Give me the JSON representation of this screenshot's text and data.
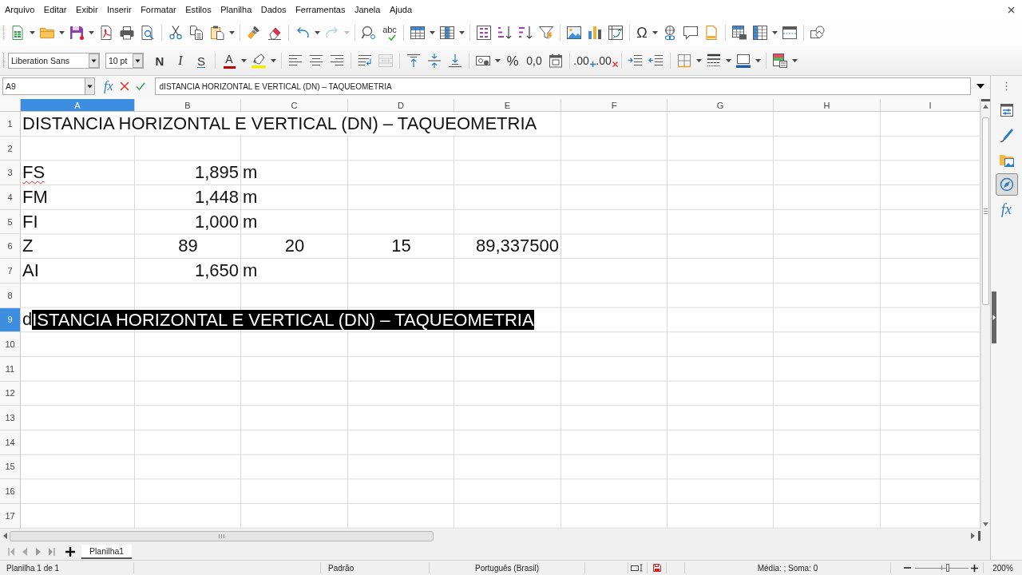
{
  "menu": [
    "Arquivo",
    "Editar",
    "Exibir",
    "Inserir",
    "Formatar",
    "Estilos",
    "Planilha",
    "Dados",
    "Ferramentas",
    "Janela",
    "Ajuda"
  ],
  "toolbar_1": [
    [
      {
        "disabled": false
      },
      {
        "disabled": false
      },
      {
        "disabled": false
      },
      {
        "disabled": false
      },
      {
        "disabled": false
      },
      {
        "disabled": false
      }
    ],
    [
      {
        "disabled": false
      },
      {
        "disabled": false
      },
      {
        "disabled": false
      }
    ],
    [
      {
        "disabled": false
      },
      {
        "disabled": false
      }
    ],
    [
      {
        "disabled": false
      },
      {
        "disabled": true
      }
    ],
    [
      {
        "disabled": false
      },
      {
        "label": "abc",
        "disabled": false
      }
    ],
    [
      {
        "disabled": false
      },
      {
        "disabled": false
      }
    ],
    [
      {
        "disabled": false
      },
      {
        "disabled": false
      },
      {
        "disabled": false
      },
      {
        "disabled": false
      }
    ],
    [
      {
        "disabled": false
      },
      {
        "disabled": false
      },
      {
        "disabled": false
      }
    ],
    [
      {
        "label": "Ω",
        "disabled": false
      },
      {
        "disabled": false
      },
      {
        "disabled": false
      },
      {
        "disabled": false
      }
    ],
    [
      {
        "disabled": false
      },
      {
        "disabled": false
      },
      {
        "disabled": false
      }
    ],
    [
      {
        "disabled": false
      }
    ]
  ],
  "toolbar_2": {
    "font_name": "Liberation Sans",
    "font_size": "10 pt",
    "groups": [
      [
        {
          "label": "N",
          "disabled": false
        },
        {
          "label": "I",
          "disabled": false
        },
        {
          "label": "S",
          "disabled": false
        }
      ],
      [
        {
          "label": "A",
          "disabled": false
        },
        {
          "disabled": false
        }
      ],
      [
        {
          "disabled": false
        },
        {
          "disabled": false
        },
        {
          "disabled": false
        }
      ],
      [
        {
          "disabled": false
        },
        {
          "disabled": true
        }
      ],
      [
        {
          "disabled": false
        },
        {
          "disabled": false
        },
        {
          "disabled": false
        }
      ],
      [
        {
          "disabled": false
        },
        {
          "label": "%",
          "disabled": false
        },
        {
          "label": "0,0",
          "disabled": false
        },
        {
          "disabled": false
        }
      ],
      [
        {
          "label": ".00",
          "disabled": false
        },
        {
          "label": ".00",
          "disabled": false
        }
      ],
      [
        {
          "disabled": false
        },
        {
          "disabled": false
        }
      ],
      [
        {
          "disabled": false
        },
        {
          "disabled": false
        },
        {
          "disabled": false
        }
      ],
      [
        {
          "disabled": false
        }
      ]
    ]
  },
  "formula_bar": {
    "cell_reference": "A9",
    "function_label": "fx",
    "content": "dISTANCIA HORIZONTAL E VERTICAL (DN) – TAQUEOMETRIA"
  },
  "columns": [
    {
      "label": "A",
      "selected": true
    },
    {
      "label": "B",
      "selected": false
    },
    {
      "label": "C",
      "selected": false
    },
    {
      "label": "D",
      "selected": false
    },
    {
      "label": "E",
      "selected": false
    },
    {
      "label": "F",
      "selected": false
    },
    {
      "label": "G",
      "selected": false
    },
    {
      "label": "H",
      "selected": false
    },
    {
      "label": "I",
      "selected": false
    }
  ],
  "rows": [
    {
      "number": "1",
      "selected": false,
      "cells": [
        {
          "text": "DISTANCIA HORIZONTAL E VERTICAL (DN) – TAQUEOMETRIA",
          "kind": "text",
          "misspelled": false
        }
      ]
    },
    {
      "number": "2",
      "selected": false
    },
    {
      "number": "3",
      "selected": false,
      "cells": [
        {
          "text": "FS",
          "kind": "text",
          "misspelled": true
        },
        {
          "text": "1,895",
          "kind": "number",
          "misspelled": false
        },
        {
          "text": "m",
          "kind": "text",
          "misspelled": false
        }
      ]
    },
    {
      "number": "4",
      "selected": false,
      "cells": [
        {
          "text": "FM",
          "kind": "text",
          "misspelled": false
        },
        {
          "text": "1,448",
          "kind": "number",
          "misspelled": false
        },
        {
          "text": "m",
          "kind": "text",
          "misspelled": false
        }
      ]
    },
    {
      "number": "5",
      "selected": false,
      "cells": [
        {
          "text": "FI",
          "kind": "text",
          "misspelled": false
        },
        {
          "text": "1,000",
          "kind": "number",
          "misspelled": false
        },
        {
          "text": "m",
          "kind": "text",
          "misspelled": false
        }
      ]
    },
    {
      "number": "6",
      "selected": false,
      "cells": [
        {
          "text": "Z",
          "kind": "text",
          "misspelled": false
        },
        {
          "text": "89",
          "kind": "centered",
          "misspelled": false
        },
        {
          "text": "20",
          "kind": "centered",
          "misspelled": false
        },
        {
          "text": "15",
          "kind": "centered",
          "misspelled": false
        },
        {
          "text": "89,337500",
          "kind": "number",
          "misspelled": false
        }
      ]
    },
    {
      "number": "7",
      "selected": false,
      "cells": [
        {
          "text": "AI",
          "kind": "text",
          "misspelled": false
        },
        {
          "text": "1,650",
          "kind": "number",
          "misspelled": false
        },
        {
          "text": "m",
          "kind": "text",
          "misspelled": false
        }
      ]
    },
    {
      "number": "8",
      "selected": false
    },
    {
      "number": "9",
      "selected": true,
      "cells": [
        {
          "text": "d",
          "selected_text": "ISTANCIA HORIZONTAL E VERTICAL (DN) – TAQUEOMETRIA",
          "kind": "editing",
          "misspelled": false
        }
      ]
    },
    {
      "number": "10",
      "selected": false
    },
    {
      "number": "11",
      "selected": false
    },
    {
      "number": "12",
      "selected": false
    },
    {
      "number": "13",
      "selected": false
    },
    {
      "number": "14",
      "selected": false
    },
    {
      "number": "15",
      "selected": false
    },
    {
      "number": "16",
      "selected": false
    },
    {
      "number": "17",
      "selected": false
    }
  ],
  "sheet_tabs": [
    {
      "label": "Planilha1",
      "selected": true
    }
  ],
  "sidebar": [
    {
      "selected": false
    },
    {
      "selected": false
    },
    {
      "selected": false
    },
    {
      "selected": true
    },
    {
      "label": "fx",
      "selected": false
    }
  ],
  "status_bar": {
    "sheet": "Planilha 1 de 1",
    "page_style": "Padrão",
    "language": "Português (Brasil)",
    "summary": "Média: ; Soma: 0",
    "zoom": {
      "level": 0.61,
      "reading": "200%"
    }
  }
}
